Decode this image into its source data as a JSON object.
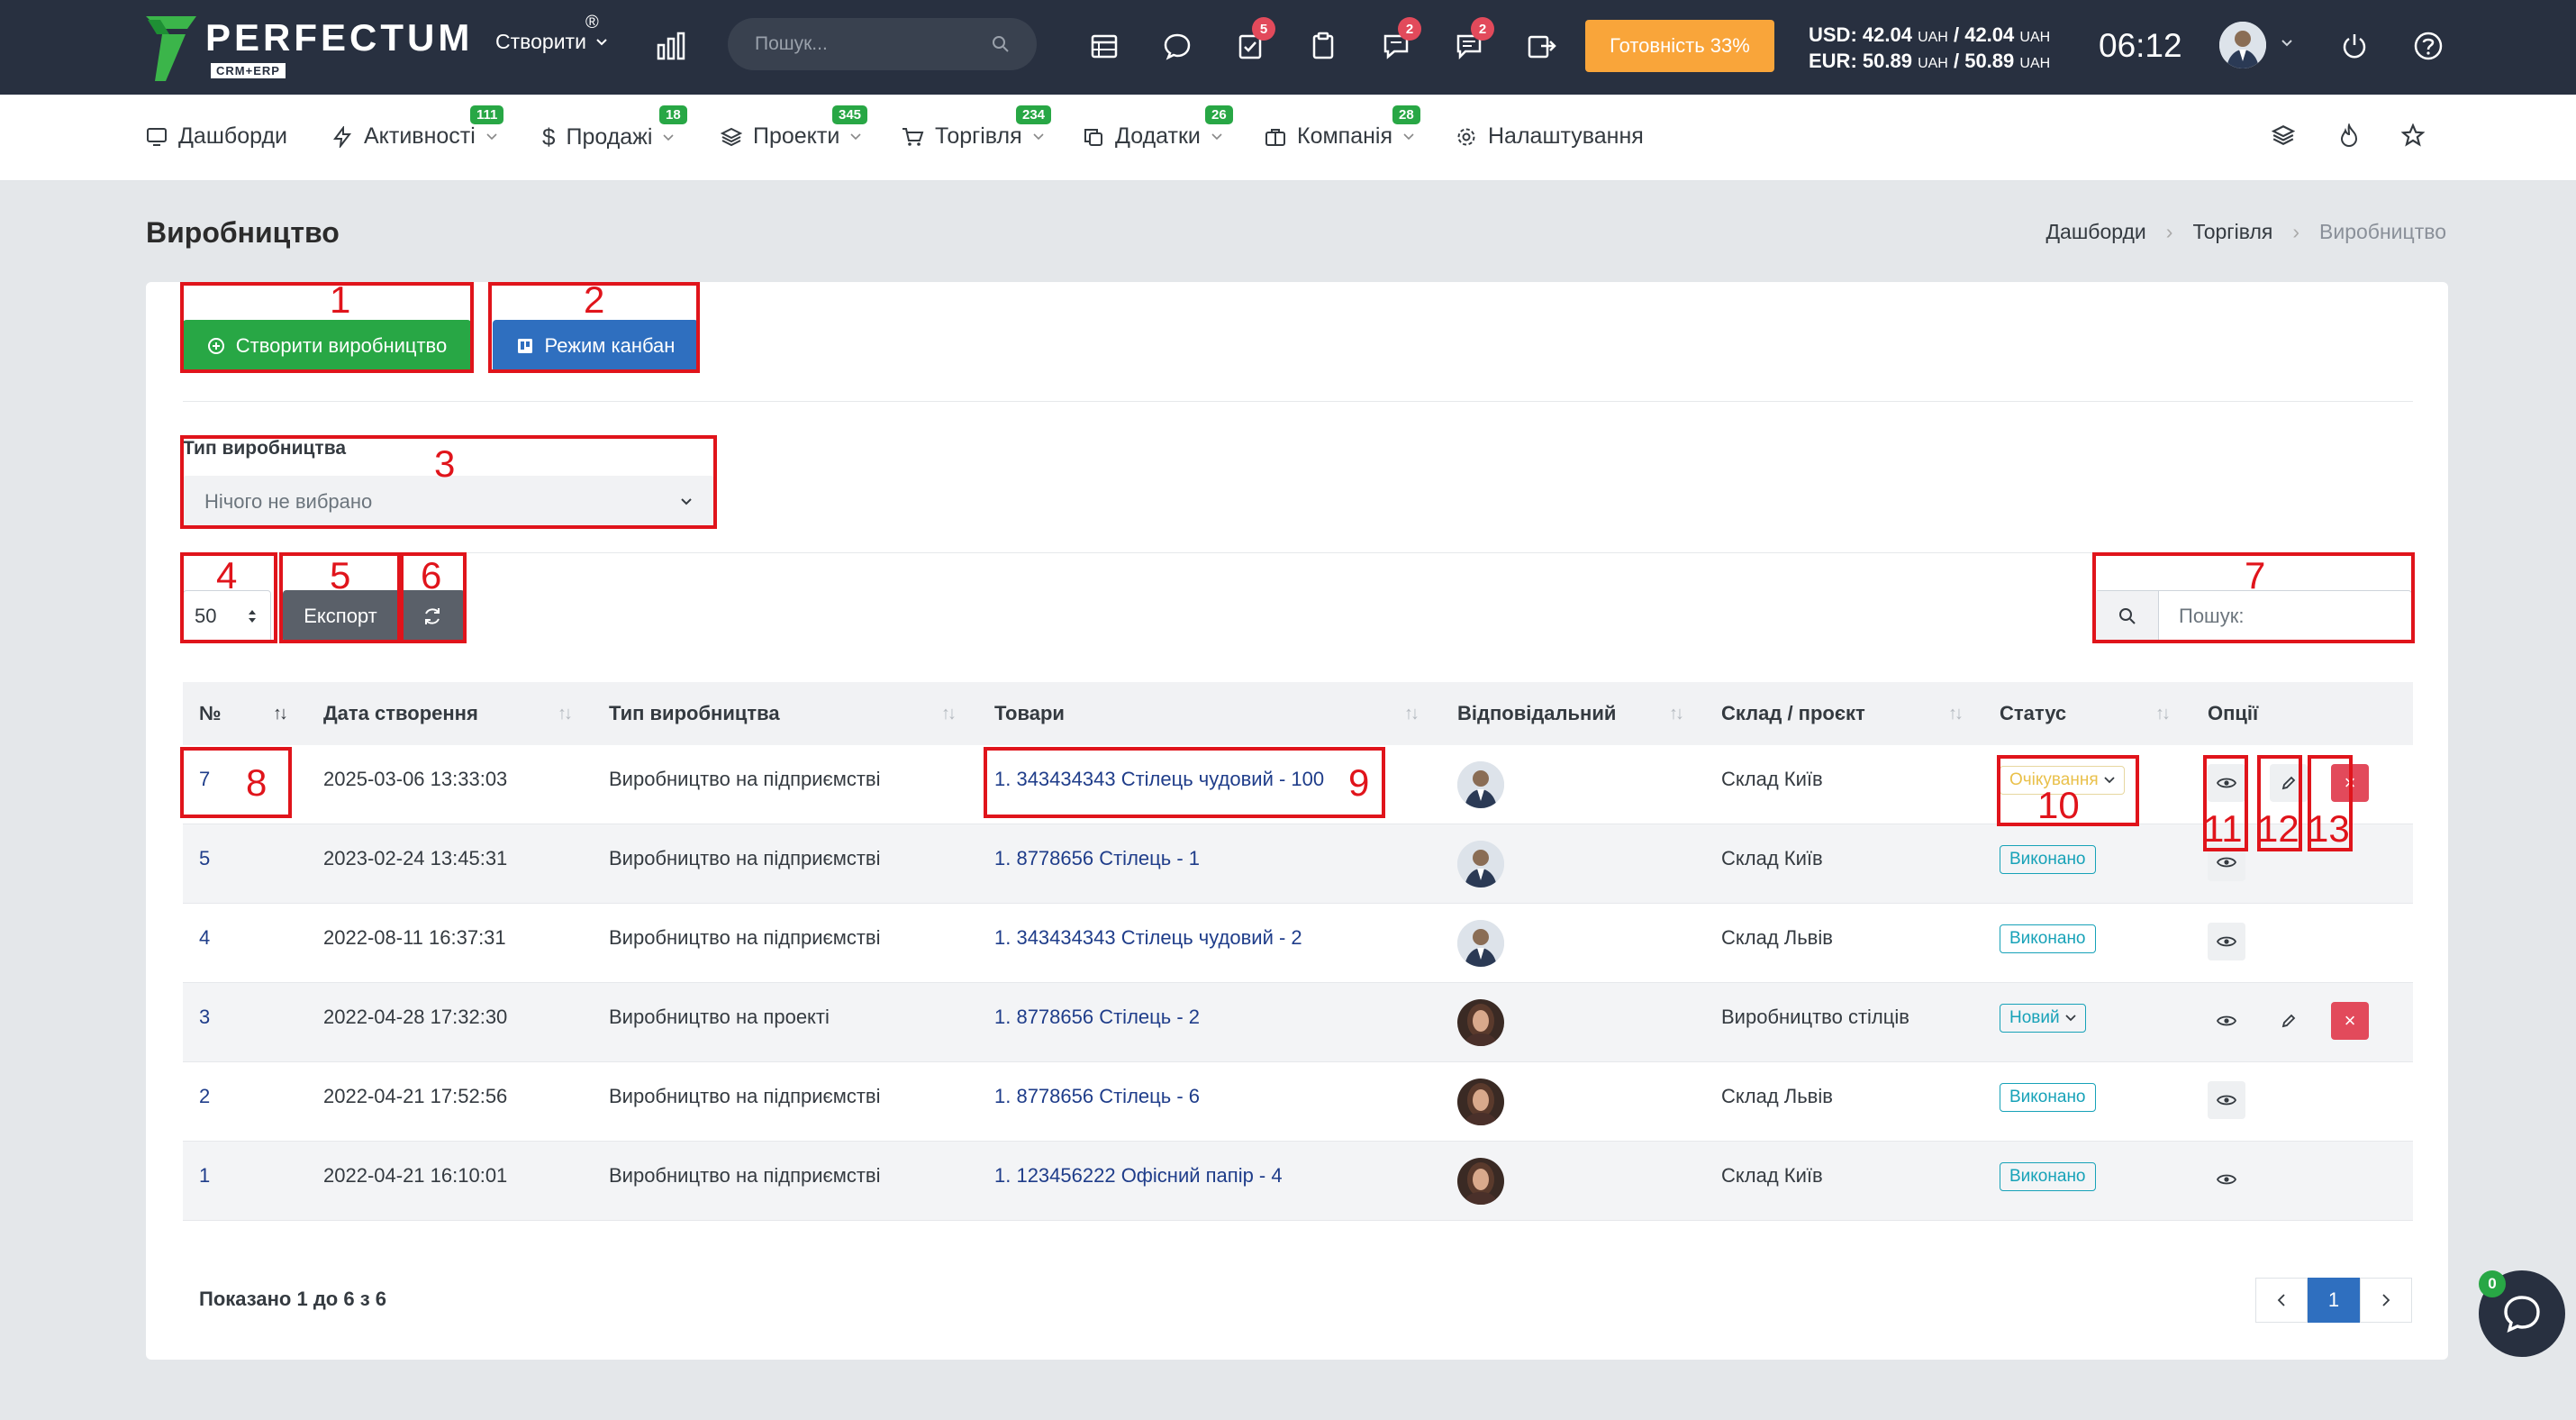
{
  "header": {
    "logo_text": "PERFECTUM",
    "logo_reg": "®",
    "logo_sub": "CRM+ERP",
    "create_label": "Створити",
    "search_placeholder": "Пошук...",
    "badges": {
      "tasks": "5",
      "chat": "2",
      "messages": "2"
    },
    "ready_label": "Готовність 33%",
    "fx_usd": "USD: 42.04",
    "fx_usd_tail": "/ 42.04",
    "fx_eur": "EUR: 50.89",
    "fx_eur_tail": "/ 50.89",
    "fx_unit": "UAH",
    "time": "06:12"
  },
  "nav": {
    "items": [
      {
        "label": "Дашборди",
        "badge": ""
      },
      {
        "label": "Активності",
        "badge": "111"
      },
      {
        "label": "Продажі",
        "badge": "18"
      },
      {
        "label": "Проекти",
        "badge": "345"
      },
      {
        "label": "Торгівля",
        "badge": "234"
      },
      {
        "label": "Додатки",
        "badge": "26"
      },
      {
        "label": "Компанія",
        "badge": "28"
      },
      {
        "label": "Налаштування",
        "badge": ""
      }
    ]
  },
  "page": {
    "title": "Виробництво",
    "breadcrumb": [
      "Дашборди",
      "Торгівля",
      "Виробництво"
    ]
  },
  "toolbar": {
    "create_label": "Створити виробництво",
    "kanban_label": "Режим канбан",
    "ptype_label": "Тип виробництва",
    "ptype_value": "Нічого не вибрано",
    "page_length": "50",
    "export_label": "Експорт",
    "search_placeholder": "Пошук:"
  },
  "annotations": [
    "1",
    "2",
    "3",
    "4",
    "5",
    "6",
    "7",
    "8",
    "9",
    "10",
    "11",
    "12",
    "13"
  ],
  "table": {
    "columns": [
      "№",
      "Дата створення",
      "Тип виробництва",
      "Товари",
      "Відповідальний",
      "Склад / проєкт",
      "Статус",
      "Опції"
    ],
    "rows": [
      {
        "id": "7",
        "date": "2025-03-06 13:33:03",
        "type": "Виробництво на підприємстві",
        "goods": "1. 343434343 Стілець чудовий - 100",
        "warehouse": "Склад Київ",
        "status": "Очікування",
        "avatar": "man"
      },
      {
        "id": "5",
        "date": "2023-02-24 13:45:31",
        "type": "Виробництво на підприємстві",
        "goods": "1. 8778656 Стілець - 1",
        "warehouse": "Склад Київ",
        "status": "Виконано",
        "avatar": "man"
      },
      {
        "id": "4",
        "date": "2022-08-11 16:37:31",
        "type": "Виробництво на підприємстві",
        "goods": "1. 343434343 Стілець чудовий - 2",
        "warehouse": "Склад Львів",
        "status": "Виконано",
        "avatar": "man"
      },
      {
        "id": "3",
        "date": "2022-04-28 17:32:30",
        "type": "Виробництво на проекті",
        "goods": "1. 8778656 Стілець - 2",
        "warehouse": "Виробництво стілців",
        "status": "Новий",
        "avatar": "woman"
      },
      {
        "id": "2",
        "date": "2022-04-21 17:52:56",
        "type": "Виробництво на підприємстві",
        "goods": "1. 8778656 Стілець - 6",
        "warehouse": "Склад Львів",
        "status": "Виконано",
        "avatar": "woman"
      },
      {
        "id": "1",
        "date": "2022-04-21 16:10:01",
        "type": "Виробництво на підприємстві",
        "goods": "1. 123456222 Офісний папір - 4",
        "warehouse": "Склад Київ",
        "status": "Виконано",
        "avatar": "woman"
      }
    ]
  },
  "footer": {
    "info": "Показано 1 до 6 з 6",
    "page": "1",
    "chat_badge": "0"
  },
  "colors": {
    "header_bg": "#283040",
    "accent_green": "#28a745",
    "accent_blue": "#2f6fbf",
    "ready_orange": "#f9a53a",
    "danger": "#e24a5b",
    "annotation_red": "#e0141b"
  }
}
